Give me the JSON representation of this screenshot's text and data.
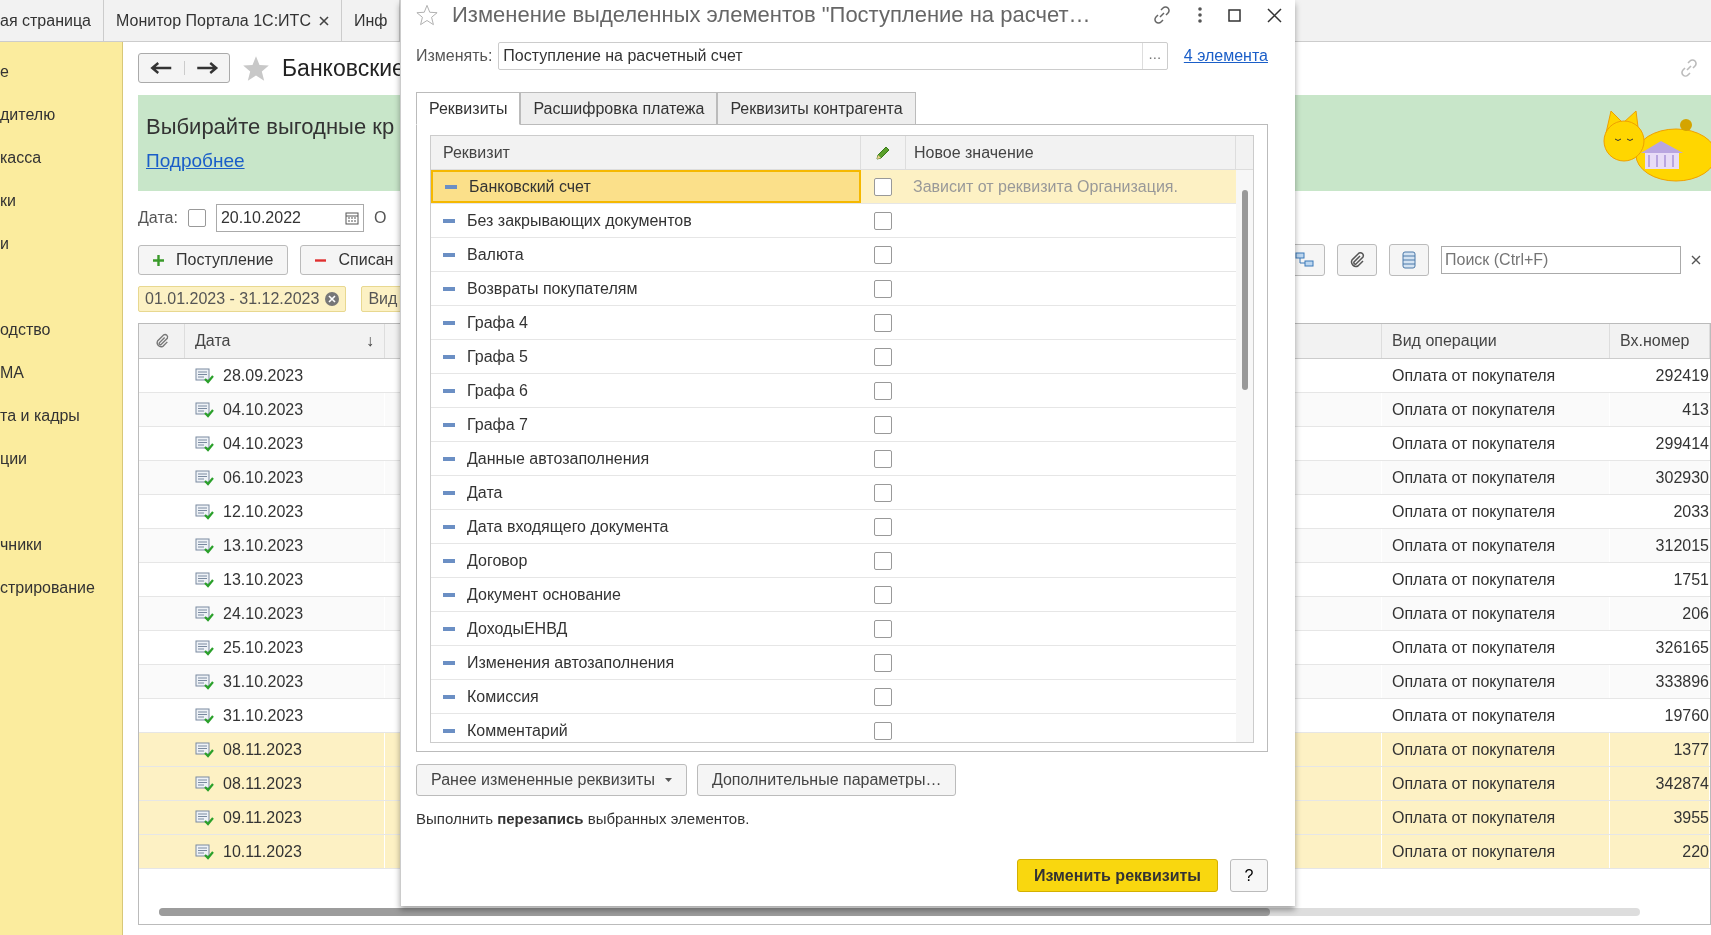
{
  "browser_tabs": [
    {
      "label": "ая страница",
      "closable": false
    },
    {
      "label": "Монитор Портала 1С:ИТС",
      "closable": true
    },
    {
      "label": "Инф",
      "closable": false
    }
  ],
  "sidebar": {
    "items": [
      "е",
      "дителю",
      "касса",
      "ки",
      "и",
      "одство",
      "МА",
      "та и кадры",
      "ции",
      "чники",
      "стрирование"
    ]
  },
  "page": {
    "title": "Банковские",
    "banner": {
      "text": "Выбирайте выгодные кр",
      "link": "Подробнее"
    },
    "date_filter": {
      "label": "Дата:",
      "checked": false,
      "value": "20.10.2022",
      "next_label": "О"
    },
    "buttons": [
      {
        "label": "Поступление",
        "kind": "add"
      },
      {
        "label": "Списан",
        "kind": "remove"
      }
    ],
    "search": {
      "placeholder": "Поиск (Ctrl+F)"
    },
    "filters": [
      {
        "label": "01.01.2023 - 31.12.2023",
        "removable": true
      },
      {
        "label": "Вид",
        "removable": false
      }
    ],
    "table": {
      "columns": [
        "Дата",
        "Вид операции",
        "Вх.номер"
      ],
      "sort_mark": "↓",
      "rows": [
        {
          "date": "28.09.2023",
          "operation": "Оплата от покупателя",
          "number": "292419",
          "selected": false
        },
        {
          "date": "04.10.2023",
          "operation": "Оплата от покупателя",
          "number": "413",
          "selected": false
        },
        {
          "date": "04.10.2023",
          "operation": "Оплата от покупателя",
          "number": "299414",
          "selected": false
        },
        {
          "date": "06.10.2023",
          "operation": "Оплата от покупателя",
          "number": "302930",
          "selected": false
        },
        {
          "date": "12.10.2023",
          "operation": "Оплата от покупателя",
          "number": "2033",
          "selected": false
        },
        {
          "date": "13.10.2023",
          "operation": "Оплата от покупателя",
          "number": "312015",
          "selected": false
        },
        {
          "date": "13.10.2023",
          "operation": "Оплата от покупателя",
          "number": "1751",
          "selected": false
        },
        {
          "date": "24.10.2023",
          "operation": "Оплата от покупателя",
          "number": "206",
          "selected": false
        },
        {
          "date": "25.10.2023",
          "operation": "Оплата от покупателя",
          "number": "326165",
          "selected": false
        },
        {
          "date": "31.10.2023",
          "operation": "Оплата от покупателя",
          "number": "333896",
          "selected": false
        },
        {
          "date": "31.10.2023",
          "operation": "Оплата от покупателя",
          "number": "19760",
          "selected": false
        },
        {
          "date": "08.11.2023",
          "operation": "Оплата от покупателя",
          "number": "1377",
          "selected": true
        },
        {
          "date": "08.11.2023",
          "operation": "Оплата от покупателя",
          "number": "342874",
          "selected": true
        },
        {
          "date": "09.11.2023",
          "operation": "Оплата от покупателя",
          "number": "3955",
          "selected": true
        },
        {
          "date": "10.11.2023",
          "operation": "Оплата от покупателя",
          "number": "220",
          "selected": true
        }
      ]
    }
  },
  "dialog": {
    "title": "Изменение выделенных элементов \"Поступление на расчет…",
    "change_label": "Изменять:",
    "change_value": "Поступление на расчетный счет",
    "choice_button": "...",
    "count_link": "4 элемента",
    "tabs": [
      {
        "label": "Реквизиты",
        "selected": true
      },
      {
        "label": "Расшифровка платежа",
        "selected": false
      },
      {
        "label": "Реквизиты контрагента",
        "selected": false
      }
    ],
    "table": {
      "columns": [
        "Реквизит",
        "Новое значение"
      ],
      "rows": [
        {
          "name": "Банковский счет",
          "checked": false,
          "selected": true,
          "value": "Зависит от реквизита Организация."
        },
        {
          "name": "Без закрывающих документов",
          "checked": false,
          "selected": false
        },
        {
          "name": "Валюта",
          "checked": false,
          "selected": false
        },
        {
          "name": "Возвраты покупателям",
          "checked": false,
          "selected": false
        },
        {
          "name": "Графа 4",
          "checked": false,
          "selected": false
        },
        {
          "name": "Графа 5",
          "checked": false,
          "selected": false
        },
        {
          "name": "Графа 6",
          "checked": false,
          "selected": false
        },
        {
          "name": "Графа 7",
          "checked": false,
          "selected": false
        },
        {
          "name": "Данные автозаполнения",
          "checked": false,
          "selected": false
        },
        {
          "name": "Дата",
          "checked": false,
          "selected": false
        },
        {
          "name": "Дата входящего документа",
          "checked": false,
          "selected": false
        },
        {
          "name": "Договор",
          "checked": false,
          "selected": false
        },
        {
          "name": "Документ основание",
          "checked": false,
          "selected": false
        },
        {
          "name": "ДоходыЕНВД",
          "checked": false,
          "selected": false
        },
        {
          "name": "Изменения автозаполнения",
          "checked": false,
          "selected": false
        },
        {
          "name": "Комиссия",
          "checked": false,
          "selected": false
        },
        {
          "name": "Комментарий",
          "checked": false,
          "selected": false
        }
      ]
    },
    "buttons": [
      {
        "label": "Ранее измененные реквизиты",
        "dropdown": true
      },
      {
        "label": "Дополнительные параметры…",
        "dropdown": false
      }
    ],
    "note": "Выполнить **перезапись** выбранных элементов.",
    "primary_button": "Изменить реквизиты",
    "help_button": "?"
  }
}
